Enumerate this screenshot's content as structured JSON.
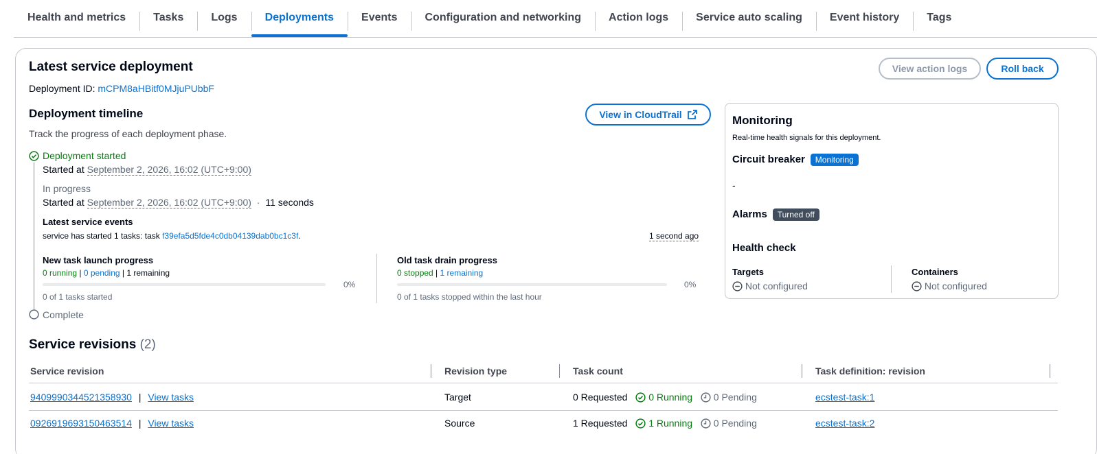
{
  "tabs": [
    "Health and metrics",
    "Tasks",
    "Logs",
    "Deployments",
    "Events",
    "Configuration and networking",
    "Action logs",
    "Service auto scaling",
    "Event history",
    "Tags"
  ],
  "active_tab": "Deployments",
  "deployment": {
    "title": "Latest service deployment",
    "id_label": "Deployment ID:",
    "id_value": "mCPM8aHBitf0MJjuPUbbF",
    "view_action_logs": "View action logs",
    "roll_back": "Roll back"
  },
  "timeline": {
    "title": "Deployment timeline",
    "description": "Track the progress of each deployment phase.",
    "cloudtrail_button": "View in CloudTrail",
    "step1": {
      "label": "Deployment started",
      "started_prefix": "Started at",
      "started_at": "September 2, 2026, 16:02 (UTC+9:00)"
    },
    "step2": {
      "label": "In progress",
      "started_prefix": "Started at",
      "started_at": "September 2, 2026, 16:02 (UTC+9:00)",
      "separator": "·",
      "duration": "11 seconds",
      "events_title": "Latest service events",
      "event_text": "service has started 1 tasks: task",
      "event_task_id": "f39efa5d5fde4c0db04139dab0bc1c3f",
      "event_period": ".",
      "event_time": "1 second ago"
    },
    "new_task": {
      "title": "New task launch progress",
      "running": "0 running",
      "pending": "0 pending",
      "remaining": "1 remaining",
      "percent": "0%",
      "progress": 0,
      "footer": "0 of 1 tasks started"
    },
    "old_task": {
      "title": "Old task drain progress",
      "stopped": "0 stopped",
      "remaining": "1 remaining",
      "percent": "0%",
      "progress": 0,
      "footer": "0 of 1 tasks stopped within the last hour"
    },
    "step3": {
      "label": "Complete"
    }
  },
  "monitoring": {
    "title": "Monitoring",
    "description": "Real-time health signals for this deployment.",
    "circuit_breaker": "Circuit breaker",
    "circuit_badge": "Monitoring",
    "circuit_value": "-",
    "alarms": "Alarms",
    "alarms_badge": "Turned off",
    "health_check": "Health check",
    "targets_label": "Targets",
    "targets_value": "Not configured",
    "containers_label": "Containers",
    "containers_value": "Not configured"
  },
  "revisions": {
    "title": "Service revisions",
    "count": "(2)",
    "headers": [
      "Service revision",
      "Revision type",
      "Task count",
      "Task definition: revision"
    ],
    "rows": [
      {
        "revision": "9409990344521358930",
        "view_tasks": "View tasks",
        "type": "Target",
        "requested": "0 Requested",
        "running": "0 Running",
        "pending": "0 Pending",
        "task_def": "ecstest-task:1"
      },
      {
        "revision": "0926919693150463514",
        "view_tasks": "View tasks",
        "type": "Source",
        "requested": "1 Requested",
        "running": "1 Running",
        "pending": "0 Pending",
        "task_def": "ecstest-task:2"
      }
    ]
  },
  "colors": {
    "accent": "#0972d3",
    "success": "#037f0c",
    "border": "#c6c6cd",
    "text": "#000716"
  },
  "icons": [
    "check-circle-icon",
    "external-link-icon",
    "empty-circle-icon",
    "minus-circle-icon",
    "clock-icon"
  ]
}
